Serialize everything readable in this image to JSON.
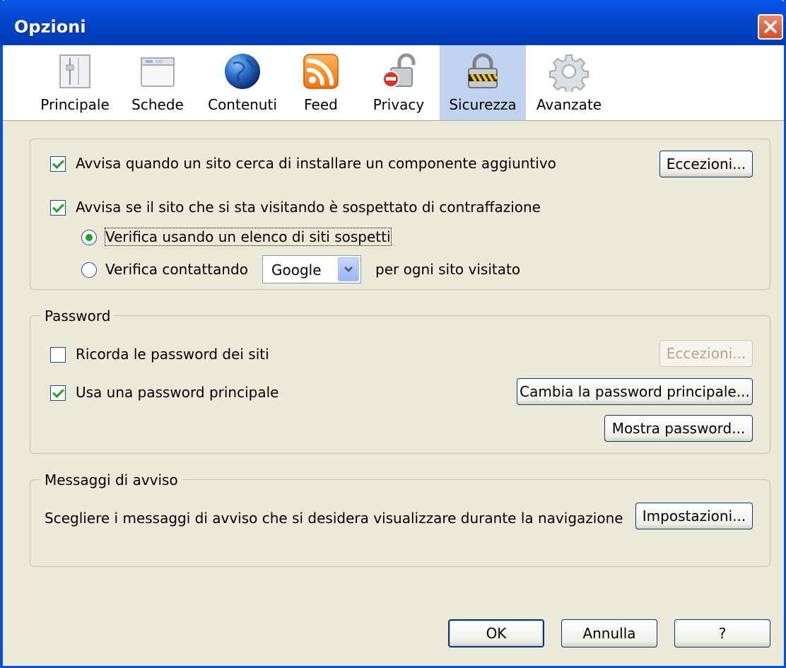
{
  "window": {
    "title": "Opzioni"
  },
  "toolbar": {
    "tabs": [
      {
        "label": "Principale",
        "icon": "general-icon"
      },
      {
        "label": "Schede",
        "icon": "tabs-icon"
      },
      {
        "label": "Contenuti",
        "icon": "globe-icon"
      },
      {
        "label": "Feed",
        "icon": "rss-feed-icon"
      },
      {
        "label": "Privacy",
        "icon": "privacy-lock-icon"
      },
      {
        "label": "Sicurezza",
        "icon": "security-padlock-icon",
        "selected": true
      },
      {
        "label": "Avanzate",
        "icon": "gear-icon"
      }
    ]
  },
  "security": {
    "addon_warning": {
      "label": "Avvisa quando un sito cerca di installare un componente aggiuntivo",
      "checked": true
    },
    "addon_exceptions_button": "Eccezioni...",
    "phishing_warning": {
      "label": "Avvisa se il sito che si sta visitando è sospettato di contraffazione",
      "checked": true
    },
    "check_list_radio": {
      "label": "Verifica usando un elenco di siti sospetti",
      "checked": true
    },
    "check_contact_radio": {
      "label": "Verifica contattando",
      "checked": false
    },
    "provider_select": {
      "value": "Google"
    },
    "per_site_text": "per ogni sito visitato"
  },
  "password": {
    "group_title": "Password",
    "remember": {
      "label": "Ricorda le password dei siti",
      "checked": false
    },
    "exceptions_button": "Eccezioni...",
    "master": {
      "label": "Usa una password principale",
      "checked": true
    },
    "change_master_button": "Cambia la password principale...",
    "show_passwords_button": "Mostra password..."
  },
  "warnings": {
    "group_title": "Messaggi di avviso",
    "description": "Scegliere i messaggi di avviso che si desidera visualizzare durante la navigazione",
    "settings_button": "Impostazioni..."
  },
  "footer": {
    "ok": "OK",
    "cancel": "Annulla",
    "help": "?"
  },
  "colors": {
    "titlebar": "#0a56e8",
    "dialog_bg": "#ece9d8",
    "selected_tab": "#c1d2ee",
    "check_green": "#21a121"
  }
}
